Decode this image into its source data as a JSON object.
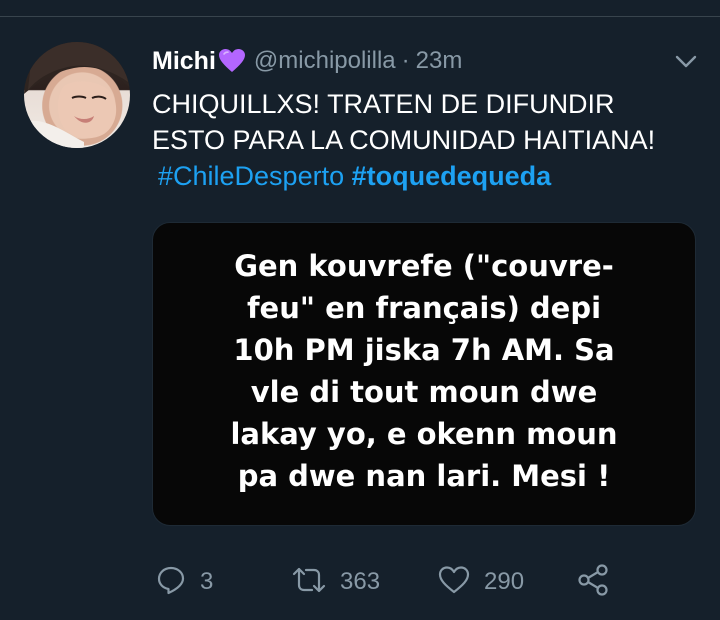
{
  "tweet": {
    "display_name": "Michi",
    "name_emoji": "purple-heart-icon",
    "handle": "@michipolilla",
    "separator": "·",
    "time": "23m",
    "text_lines": [
      "CHIQUILLXS! TRATEN DE DIFUNDIR",
      "ESTO PARA LA COMUNIDAD HAITIANA!"
    ],
    "hashtags": [
      "#ChileDesperto",
      "#toquedequeda"
    ],
    "image_text_lines": [
      "Gen kouvrefe (\"couvre-",
      "feu\" en français) depi",
      "10h PM jiska 7h AM. Sa",
      "vle di tout moun dwe",
      "lakay yo, e okenn moun",
      "pa dwe nan lari. Mesi !"
    ]
  },
  "actions": {
    "reply_count": "3",
    "retweet_count": "363",
    "like_count": "290"
  },
  "colors": {
    "background": "#15202b",
    "link": "#1da1f2",
    "secondary_text": "#8899a6",
    "divider": "#38444d",
    "heart": "#b366ff"
  }
}
